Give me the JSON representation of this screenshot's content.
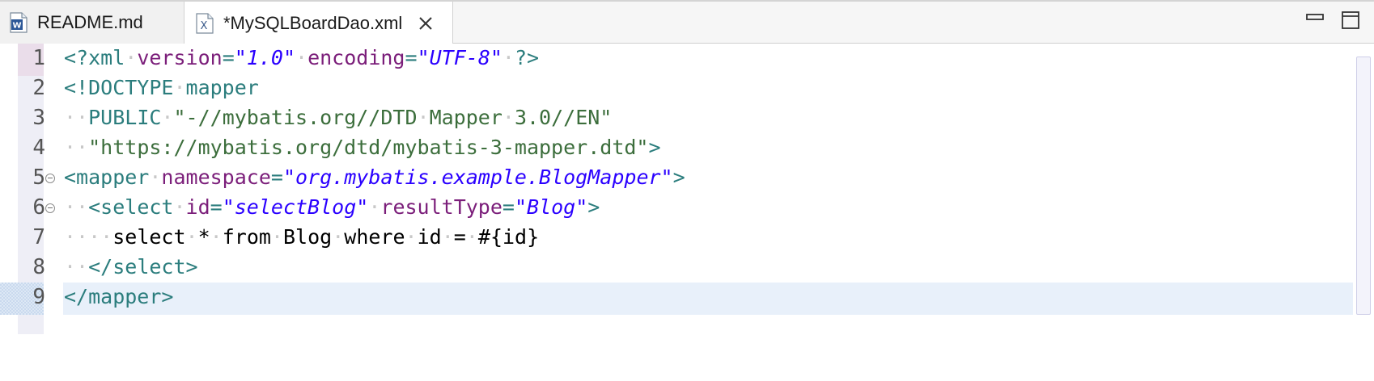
{
  "tabs": [
    {
      "label": "README.md",
      "icon": "word-doc-icon",
      "active": false
    },
    {
      "label": "*MySQLBoardDao.xml",
      "icon": "xml-file-icon",
      "active": true
    }
  ],
  "window_controls": {
    "minimize": "minimize-icon",
    "maximize": "maximize-icon"
  },
  "editor": {
    "line_numbers": [
      "1",
      "2",
      "3",
      "4",
      "5",
      "6",
      "7",
      "8",
      "9"
    ],
    "lines": [
      [
        [
          "tag",
          "<?xml"
        ],
        [
          "ws",
          "·"
        ],
        [
          "attr",
          "version"
        ],
        [
          "tag",
          "="
        ],
        [
          "str",
          "\"1.0\""
        ],
        [
          "ws",
          "·"
        ],
        [
          "attr",
          "encoding"
        ],
        [
          "tag",
          "="
        ],
        [
          "str",
          "\"UTF-8\""
        ],
        [
          "ws",
          "·"
        ],
        [
          "tag",
          "?>"
        ]
      ],
      [
        [
          "dt",
          "<!DOCTYPE"
        ],
        [
          "ws",
          "·"
        ],
        [
          "dt",
          "mapper"
        ]
      ],
      [
        [
          "ws",
          "··"
        ],
        [
          "dt",
          "PUBLIC"
        ],
        [
          "ws",
          "·"
        ],
        [
          "dtstr",
          "\"-//mybatis.org//DTD"
        ],
        [
          "ws",
          "·"
        ],
        [
          "dtstr",
          "Mapper"
        ],
        [
          "ws",
          "·"
        ],
        [
          "dtstr",
          "3.0//EN\""
        ]
      ],
      [
        [
          "ws",
          "··"
        ],
        [
          "dtstr",
          "\"https://mybatis.org/dtd/mybatis-3-mapper.dtd\""
        ],
        [
          "dt",
          ">"
        ]
      ],
      [
        [
          "tag",
          "<mapper"
        ],
        [
          "ws",
          "·"
        ],
        [
          "attr",
          "namespace"
        ],
        [
          "tag",
          "="
        ],
        [
          "str",
          "\"org.mybatis.example.BlogMapper\""
        ],
        [
          "tag",
          ">"
        ]
      ],
      [
        [
          "ws",
          "··"
        ],
        [
          "tag",
          "<select"
        ],
        [
          "ws",
          "·"
        ],
        [
          "attr",
          "id"
        ],
        [
          "tag",
          "="
        ],
        [
          "str",
          "\"selectBlog\""
        ],
        [
          "ws",
          "·"
        ],
        [
          "attr",
          "resultType"
        ],
        [
          "tag",
          "="
        ],
        [
          "str",
          "\"Blog\""
        ],
        [
          "tag",
          ">"
        ]
      ],
      [
        [
          "ws",
          "····"
        ],
        [
          "plain",
          "select"
        ],
        [
          "ws",
          "·"
        ],
        [
          "plain",
          "*"
        ],
        [
          "ws",
          "·"
        ],
        [
          "plain",
          "from"
        ],
        [
          "ws",
          "·"
        ],
        [
          "plain",
          "Blog"
        ],
        [
          "ws",
          "·"
        ],
        [
          "plain",
          "where"
        ],
        [
          "ws",
          "·"
        ],
        [
          "plain",
          "id"
        ],
        [
          "ws",
          "·"
        ],
        [
          "plain",
          "="
        ],
        [
          "ws",
          "·"
        ],
        [
          "plain",
          "#{id}"
        ]
      ],
      [
        [
          "ws",
          "··"
        ],
        [
          "tag",
          "</select>"
        ]
      ],
      [
        [
          "tag",
          "</mapper>"
        ]
      ]
    ],
    "fold_lines": [
      5,
      6
    ],
    "current_line": 9,
    "colors": {
      "tag": "#2b7d7d",
      "attribute": "#7b1e7a",
      "string": "#2a00ff",
      "doctype_string": "#3c6e3c",
      "whitespace": "#c8c8c8",
      "current_line_bg": "#e8f0fa"
    }
  }
}
